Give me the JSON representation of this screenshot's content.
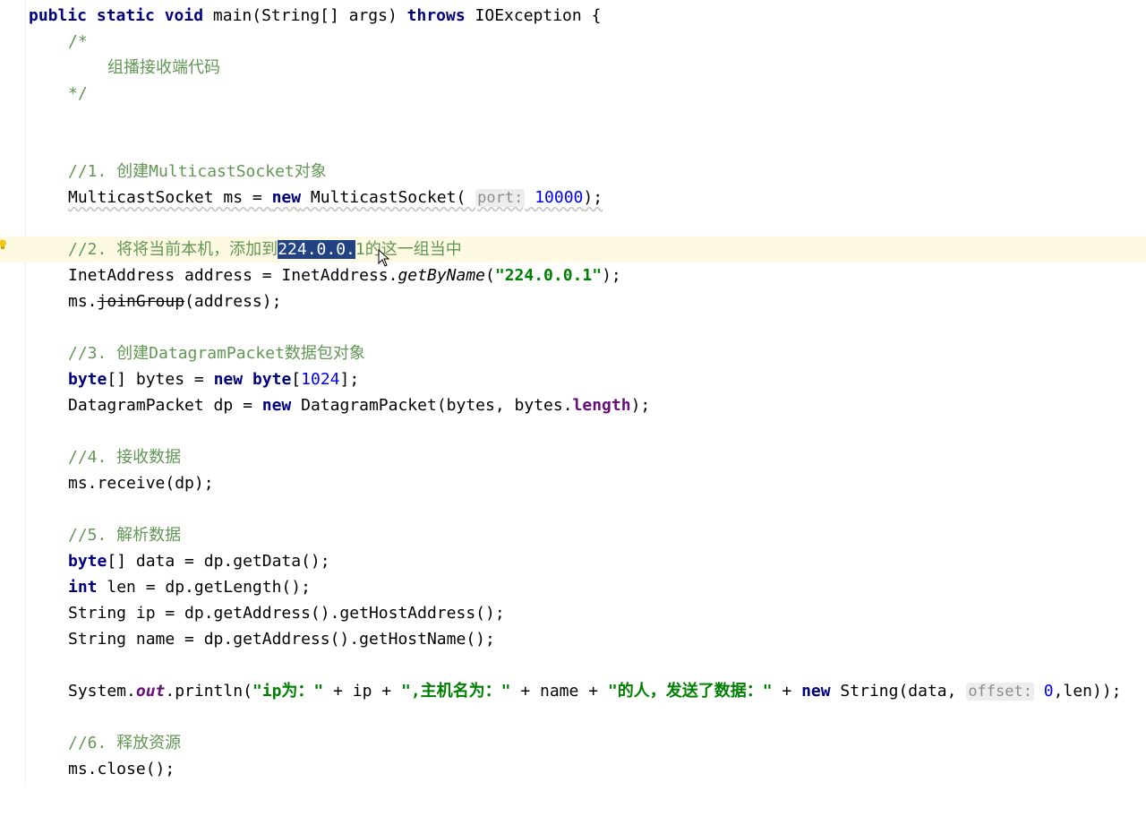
{
  "editor": {
    "language": "Java",
    "lines": {
      "l1": {
        "kw1": "public static void",
        "t1": " main(String[] args) ",
        "kw2": "throws",
        "t2": " IOException {"
      },
      "l2": {
        "c": "/*"
      },
      "l3": {
        "c": "组播接收端代码"
      },
      "l4": {
        "c": "*/"
      },
      "l5": {
        "c": "//1. 创建MulticastSocket对象"
      },
      "l6": {
        "t1": "MulticastSocket ms = ",
        "kw": "new",
        "t2": " MulticastSocket( ",
        "hint": "port:",
        "num": " 10000",
        "t3": ");"
      },
      "l7": {
        "c1": "//2. 将将当前本机，添加到",
        "sel": "224.0.0.",
        "c2": "1的这一组当中"
      },
      "l8": {
        "t1": "InetAddress address = InetAddress.",
        "static": "getByName",
        "t2": "(",
        "str": "\"224.0.0.1\"",
        "t3": ");"
      },
      "l9": {
        "t1": "ms.",
        "strike": "joinGroup",
        "t2": "(address);"
      },
      "l10": {
        "c": "//3. 创建DatagramPacket数据包对象"
      },
      "l11": {
        "kw1": "byte",
        "t1": "[] bytes = ",
        "kw2": "new",
        "sp": " ",
        "kw3": "byte",
        "t2": "[",
        "num": "1024",
        "t3": "];"
      },
      "l12": {
        "t1": "DatagramPacket dp = ",
        "kw": "new",
        "t2": " DatagramPacket(bytes, bytes.",
        "fld": "length",
        "t3": ");"
      },
      "l13": {
        "c": "//4. 接收数据"
      },
      "l14": {
        "t": "ms.receive(dp);"
      },
      "l15": {
        "c": "//5. 解析数据"
      },
      "l16": {
        "kw": "byte",
        "t": "[] data = dp.getData();"
      },
      "l17": {
        "kw": "int",
        "t": " len = dp.getLength();"
      },
      "l18": {
        "t": "String ip = dp.getAddress().getHostAddress();"
      },
      "l19": {
        "t": "String name = dp.getAddress().getHostName();"
      },
      "l20": {
        "t1": "System.",
        "sf": "out",
        "t2": ".println(",
        "s1": "\"ip为：\"",
        "t3": " + ip + ",
        "s2": "\",主机名为：\"",
        "t4": " + name + ",
        "s3": "\"的人，发送了数据：\"",
        "t5": " + ",
        "kw": "new",
        "t6": " String(data, ",
        "hint": "offset:",
        "num": " 0",
        "t7": ",len));"
      },
      "l21": {
        "c": "//6. 释放资源"
      },
      "l22": {
        "t": "ms.close();"
      }
    }
  },
  "colors": {
    "keyword": "#000080",
    "comment": "#629755",
    "string": "#008000",
    "number": "#0000ff",
    "selection": "#214283",
    "caret_line": "#fdf9e3"
  },
  "icons": {
    "intention": "lightbulb-icon",
    "pointer": "mouse-cursor-icon"
  }
}
